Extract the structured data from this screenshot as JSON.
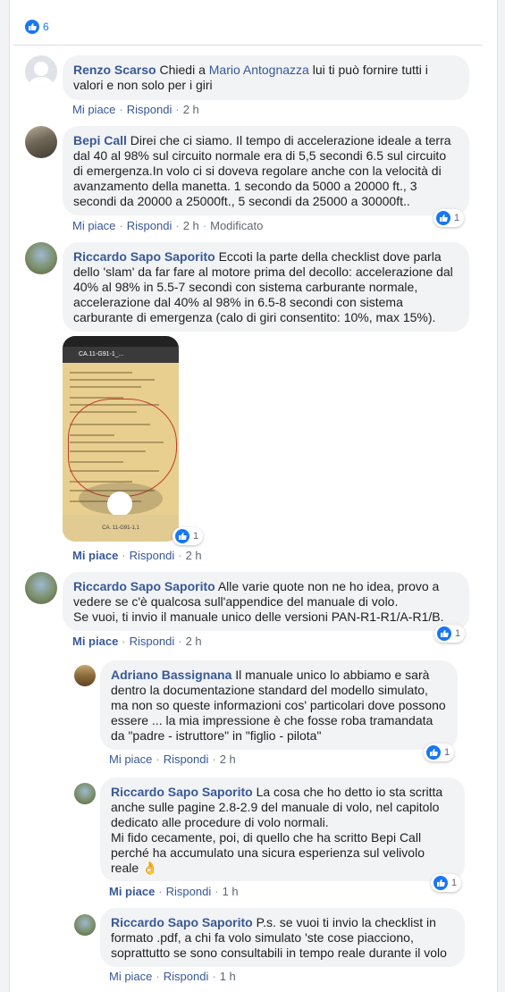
{
  "post": {
    "like_count": "6"
  },
  "comments": [
    {
      "author": "Renzo Scarso",
      "text_before": " Chiedi a ",
      "mention": "Mario Antognazza",
      "text_after": " lui ti può fornire tutti i valori e non solo per i giri",
      "like": "Mi piace",
      "reply": "Rispondi",
      "time": "2 h"
    },
    {
      "author": "Bepi Call",
      "text": " Direi che ci siamo. Il tempo di accelerazione ideale a terra dal 40 al 98% sul circuito normale era di 5,5 secondi 6.5 sul circuito di emergenza.In volo ci si doveva regolare anche con la velocità di avanzamento della manetta. 1 secondo da 5000 a 20000 ft., 3 secondi da 20000 a 25000ft., 5 secondi da 25000 a 30000ft..",
      "like": "Mi piace",
      "reply": "Rispondi",
      "time": "2 h",
      "edited": "Modificato",
      "reactions": "1"
    },
    {
      "author": "Riccardo Sapo Saporito",
      "text": " Eccoti la parte della checklist dove parla dello 'slam' da far fare al motore prima del decollo: accelerazione dal 40% al 98% in 5.5-7 secondi con sistema carburante normale, accelerazione dal 40% al 98% in 6.5-8 secondi con sistema carburante di emergenza (calo di giri consentito: 10%, max 15%).",
      "photo_title": "CA.11-G91-1_...",
      "photo_footer": "CA. 11-G91-1,1",
      "like": "Mi piace",
      "reply": "Rispondi",
      "time": "2 h",
      "reactions": "1"
    },
    {
      "author": "Riccardo Sapo Saporito",
      "text": " Alle varie quote non ne ho idea, provo a vedere se c'è qualcosa sull'appendice del manuale di volo.",
      "text2": "Se vuoi, ti invio il manuale unico delle versioni PAN-R1-R1/A-R1/B.",
      "like": "Mi piace",
      "reply": "Rispondi",
      "time": "2 h",
      "reactions": "1"
    }
  ],
  "replies": [
    {
      "author": "Adriano Bassignana",
      "text": " Il manuale unico lo abbiamo e sarà dentro la documentazione standard del modello simulato, ma non so queste informazioni cos' particolari dove possono essere ... la mia impressione è che fosse roba tramandata da \"padre - istruttore\" in \"figlio - pilota\"",
      "like": "Mi piace",
      "reply": "Rispondi",
      "time": "2 h",
      "reactions": "1"
    },
    {
      "author": "Riccardo Sapo Saporito",
      "text": " La cosa che ho detto io sta scritta anche sulle pagine 2.8-2.9 del manuale di volo, nel capitolo dedicato alle procedure di volo normali.",
      "text2": "Mi fido cecamente, poi, di quello che ha scritto Bepi Call perché ha accumulato una sicura esperienza sul velivolo reale",
      "emoji": "👌",
      "like": "Mi piace",
      "reply": "Rispondi",
      "time": "1 h",
      "reactions": "1"
    },
    {
      "author": "Riccardo Sapo Saporito",
      "text": " P.s. se vuoi ti invio la checklist in formato .pdf, a chi fa volo simulato 'ste cose piacciono, soprattutto se sono consultabili in tempo reale durante il volo",
      "like": "Mi piace",
      "reply": "Rispondi",
      "time": "1 h"
    }
  ],
  "colors": {
    "link": "#385898",
    "like_blue": "#1877f2",
    "bubble": "#f2f3f5",
    "meta": "#606770"
  }
}
